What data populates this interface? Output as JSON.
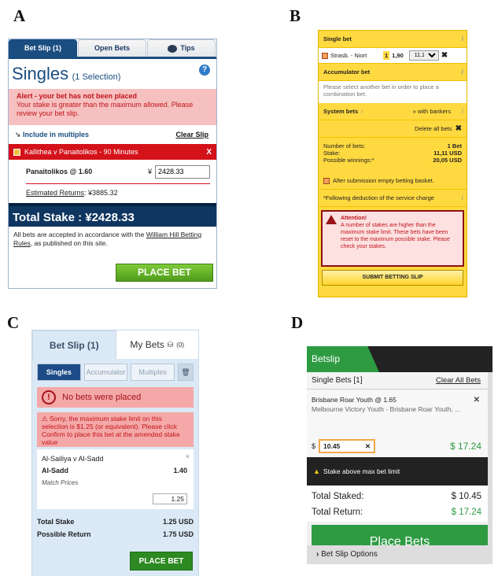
{
  "labels": {
    "a": "A",
    "b": "B",
    "c": "C",
    "d": "D"
  },
  "panel_a": {
    "tabs": [
      "Bet Slip (1)",
      "Open Bets",
      "Tips"
    ],
    "title": "Singles",
    "subtitle": "(1 Selection)",
    "alert_title": "Alert - your bet has not been placed",
    "alert_body": "Your stake is greater than the maximum allowed. Please review your bet slip.",
    "include_multiples": "Include in multiples",
    "clear_slip": "Clear Slip",
    "event": "Kallithea v Panaitolikos - 90 Minutes",
    "event_close": "X",
    "selection": "Panaitolikos @ 1.60",
    "currency": "¥",
    "stake_value": "2428.33",
    "est_label": "Estimated Returns",
    "est_value": ": ¥3885.32",
    "total_stake": "Total Stake : ¥2428.33",
    "terms_pre": "All bets are accepted in accordance with the ",
    "terms_link": "William Hill Betting Rules",
    "terms_post": ", as published on this site.",
    "place_bet": "PLACE BET",
    "colors": {
      "header": "#1a4d80",
      "alert_bg": "#f6c0c0",
      "event_bg": "#d4121a",
      "button": "#4f9c1b"
    }
  },
  "panel_b": {
    "single_bet": "Single bet",
    "bet_num": "1",
    "bet_name": "Strasb. - Niort",
    "odds": "1,90",
    "stake_select": "11,11",
    "accumulator": "Accumulator bet",
    "acc_note": "Please select another bet in order to place a combination bet.",
    "system": "System bets",
    "with_bankers": "» with bankers",
    "delete_all": "Delete all bets",
    "summary": [
      {
        "label": "Number of bets:",
        "value": "1 Bet"
      },
      {
        "label": "Stake:",
        "value": "11,11 USD"
      },
      {
        "label": "Possible winnings:*",
        "value": "20,05 USD"
      }
    ],
    "empty_basket": "After submission empty betting basket.",
    "deduction": "*Following deduction of the service charge",
    "attention": "Attention!",
    "attention_body": "A number of stakes are higher than the maximum stake limit. These bets have been reset to the maximum possible stake. Please check your stakes.",
    "submit": "SUBMIT BETTING SLIP",
    "info_icon": "i",
    "colors": {
      "bg": "#ffd940",
      "warn": "#c0151b"
    }
  },
  "panel_c": {
    "tab_betslip": "Bet Slip (1)",
    "tab_mybets": "My Bets",
    "mybets_count": "(0)",
    "seg": [
      "Singles",
      "Accumulator",
      "Multiples"
    ],
    "no_bets": "No bets were placed",
    "sorry": "Sorry, the maximum stake limit on this selection is $1.25 (or equivalent). Please click Confirm to place this bet at the amended stake value",
    "match": "Al-Sailiya v Al-Sadd",
    "selection": "Al-Sadd",
    "odds": "1.40",
    "market": "Match Prices",
    "stake": "1.25",
    "close": "×",
    "total_stake_label": "Total Stake",
    "total_stake_value": "1.25 USD",
    "possible_label": "Possible Return",
    "possible_value": "1.75 USD",
    "place_bet": "PLACE BET",
    "colors": {
      "active": "#1c4b87",
      "alert": "#f5a8a8",
      "button": "#2d8a22"
    }
  },
  "panel_d": {
    "title": "Betslip",
    "singles": "Single Bets [1]",
    "clear_all": "Clear All Bets",
    "selection": "Brisbane Roar Youth @ 1.65",
    "event": "Melbourne Victory Youth - Brisbane Roar Youth, ...",
    "remove": "✕",
    "currency": "$",
    "stake": "10.45",
    "stake_clear": "✕",
    "returns": "$ 17.24",
    "warning": "Stake above max bet limit",
    "total_staked_label": "Total Staked:",
    "total_staked_value": "$ 10.45",
    "total_return_label": "Total Return:",
    "total_return_value": "$ 17.24",
    "place_bets": "Place Bets",
    "options": "Bet Slip Options",
    "colors": {
      "brand": "#2e9b43",
      "dark": "#222222"
    }
  }
}
